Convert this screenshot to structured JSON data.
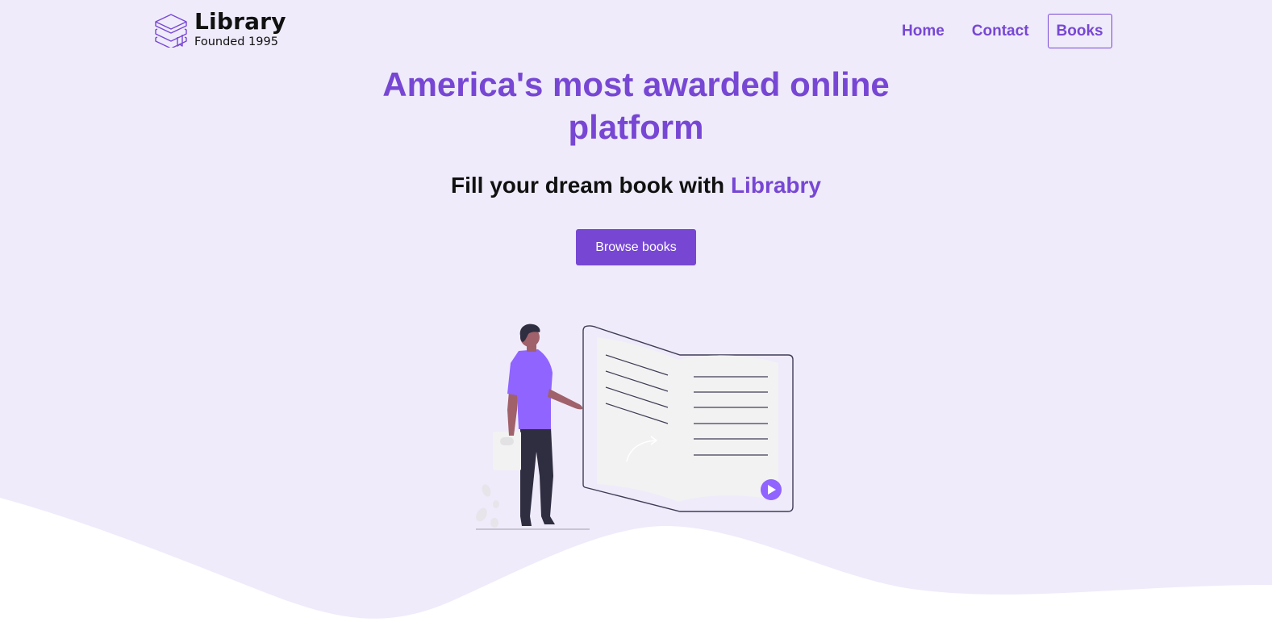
{
  "brand": {
    "title": "Library",
    "subtitle": "Founded 1995",
    "icon": "stacked-books-icon"
  },
  "nav": {
    "home": "Home",
    "contact": "Contact",
    "books": "Books",
    "active": "Books"
  },
  "hero": {
    "title": "America's most awarded online platform",
    "subtitle_prefix": "Fill your dream book with ",
    "subtitle_accent": "Librabry",
    "cta_label": "Browse books"
  },
  "illustration": {
    "description_icon": "person-reading-book-icon",
    "play_icon": "play-icon"
  },
  "colors": {
    "accent": "#7747d4",
    "background": "#efebfa",
    "figure_shirt": "#9064ff",
    "white": "#ffffff"
  }
}
